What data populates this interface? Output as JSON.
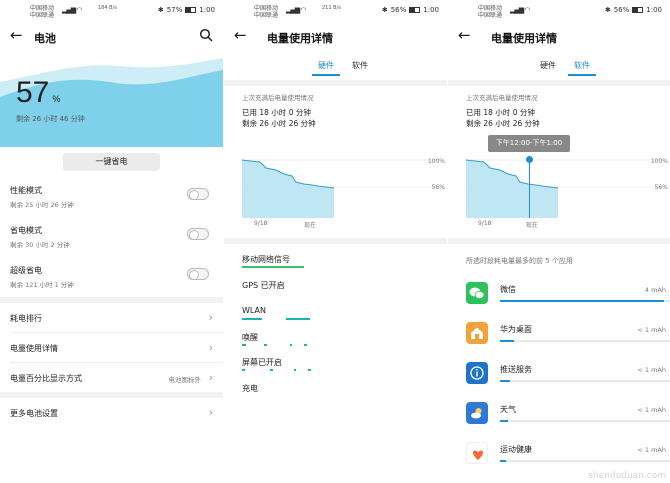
{
  "colors": {
    "accent": "#1a8fd8",
    "wave": "#7fd0ea",
    "chart_fill": "#bfe6f3",
    "chart_line": "#3a9ec8",
    "hw_green": "#3bbf6e",
    "hw_teal": "#19b3b3"
  },
  "panel1": {
    "status": {
      "carrier_1": "中国移动",
      "carrier_2": "中国联通",
      "speed": "184 B/s",
      "battery": "57%",
      "time": "1:00"
    },
    "title": "电池",
    "battery_percent": "57",
    "percent_sign": "%",
    "remaining": "剩余 26 小时 46 分钟",
    "eco_button": "一键省电",
    "modes": [
      {
        "label": "性能模式",
        "sub": "剩余 25 小时 26 分钟",
        "on": false
      },
      {
        "label": "省电模式",
        "sub": "剩余 30 小时 2 分钟",
        "on": false
      },
      {
        "label": "超级省电",
        "sub": "剩余 121 小时 1 分钟",
        "on": false
      }
    ],
    "nav": [
      {
        "label": "耗电排行",
        "value": ""
      },
      {
        "label": "电量使用详情",
        "value": ""
      },
      {
        "label": "电量百分比显示方式",
        "value": "电池图标外"
      },
      {
        "label": "更多电池设置",
        "value": ""
      }
    ]
  },
  "panel2": {
    "status": {
      "carrier_1": "中国移动",
      "carrier_2": "中国联通",
      "speed": "211 B/s",
      "battery": "56%",
      "time": "1:00"
    },
    "title": "电量使用详情",
    "tabs": [
      "硬件",
      "软件"
    ],
    "active_tab": 0,
    "since": "上次充满后电量使用情况",
    "used": "已用 18 小时 0 分钟",
    "remain": "剩余 26 小时 26 分钟",
    "y_labels": [
      "100%",
      "56%"
    ],
    "x_labels": [
      "9/18",
      "现在"
    ],
    "hardware": [
      {
        "label": "移动网络信号",
        "color": "green"
      },
      {
        "label": "GPS 已开启",
        "color": "none"
      },
      {
        "label": "WLAN",
        "color": "teal"
      },
      {
        "label": "唤醒",
        "color": "teal"
      },
      {
        "label": "屏幕已开启",
        "color": "teal"
      },
      {
        "label": "充电",
        "color": "none"
      }
    ]
  },
  "panel3": {
    "status": {
      "carrier_1": "中国移动",
      "carrier_2": "中国联通",
      "speed": "",
      "battery": "56%",
      "time": "1:00"
    },
    "title": "电量使用详情",
    "tabs": [
      "硬件",
      "软件"
    ],
    "active_tab": 1,
    "since": "上次充满后电量使用情况",
    "used": "已用 18 小时 0 分钟",
    "remain": "剩余 26 小时 26 分钟",
    "tooltip": "下午12:00-下午1:00",
    "y_labels": [
      "100%",
      "56%"
    ],
    "x_labels": [
      "9/18",
      "现在"
    ],
    "top5_title": "所选时段耗电量最多的前 5 个应用",
    "apps": [
      {
        "name": "微信",
        "value": "4 mAh",
        "fill": 0.97,
        "icon": "wechat-icon",
        "icon_color": "#2dc15c"
      },
      {
        "name": "华为桌面",
        "value": "< 1 mAh",
        "fill": 0.08,
        "icon": "home-icon",
        "icon_color": "#f0a23c"
      },
      {
        "name": "推送服务",
        "value": "< 1 mAh",
        "fill": 0.06,
        "icon": "info-icon",
        "icon_color": "#1f74c8"
      },
      {
        "name": "天气",
        "value": "< 1 mAh",
        "fill": 0.05,
        "icon": "weather-icon",
        "icon_color": "#2f79d6"
      },
      {
        "name": "运动健康",
        "value": "< 1 mAh",
        "fill": 0.04,
        "icon": "heart-icon",
        "icon_color": "#f36a3b"
      }
    ],
    "watermark": "shenduduan.com"
  }
}
